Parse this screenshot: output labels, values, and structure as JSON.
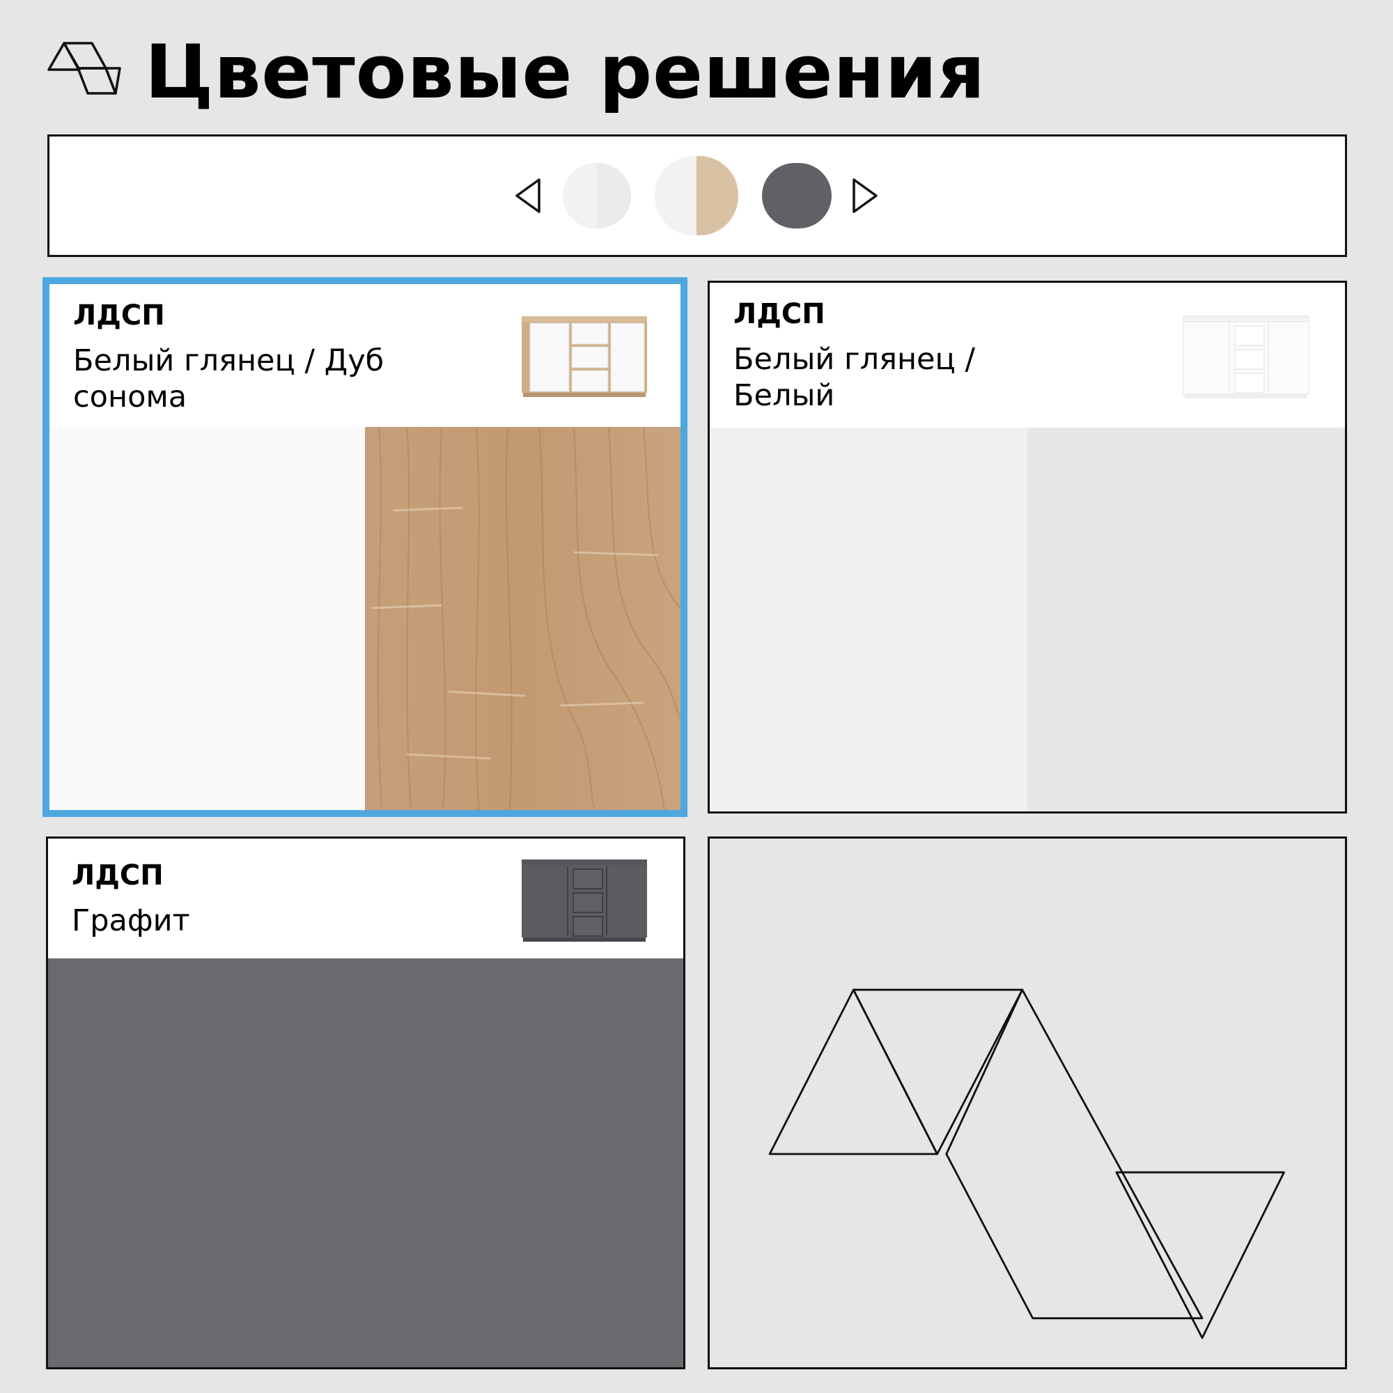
{
  "header": {
    "title": "Цветовые решения",
    "logo_icon": "triangle-ribbon-logo-icon"
  },
  "swatches": {
    "prev_icon": "triangle-left-icon",
    "next_icon": "triangle-right-icon",
    "items": [
      {
        "id": "white",
        "colors": [
          "#f2f2f2",
          "#ebebeb"
        ]
      },
      {
        "id": "white-oak",
        "colors": [
          "#f2f2f2",
          "#d9c2a4"
        ]
      },
      {
        "id": "graphite",
        "colors": [
          "#606166"
        ]
      }
    ]
  },
  "cards": [
    {
      "material": "ЛДСП",
      "name": "Белый глянец / Дуб сонома",
      "selected": true,
      "colors": {
        "left": "#fafafa",
        "right": "#c49c74",
        "outline": "#4ea8df"
      }
    },
    {
      "material": "ЛДСП",
      "name": "Белый глянец / Белый",
      "selected": false,
      "colors": {
        "left": "#f0f0f0",
        "right": "#e6e6e6"
      }
    },
    {
      "material": "ЛДСП",
      "name": "Графит",
      "selected": false,
      "colors": {
        "fill": "#696a6e"
      }
    }
  ],
  "decoration": {
    "icon": "brand-triangles-icon"
  }
}
